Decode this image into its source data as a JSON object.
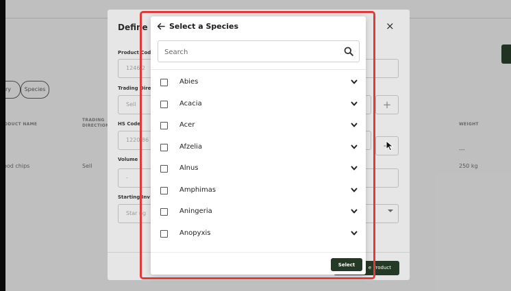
{
  "background": {
    "chips": [
      "ry",
      "Species"
    ],
    "columns": [
      "ODUCT NAME",
      "TRADING DIRECTION",
      "WEIGHT"
    ],
    "row": {
      "product": "ood chips",
      "direction": "Sell",
      "weight": "250 kg",
      "weight_above": "---"
    }
  },
  "define_modal": {
    "title": "Define P",
    "fields": [
      {
        "label": "Product Cod",
        "value": "1246 2"
      },
      {
        "label": "Trading Dire",
        "value": "Sell"
      },
      {
        "label": "HS Code",
        "value": "1220 86"
      },
      {
        "label": "Volume",
        "value": "-"
      },
      {
        "label": "Starting Inv",
        "value": "Star ng"
      }
    ],
    "primary_button": "e Product",
    "close_symbol": "×",
    "plus_symbol": "+"
  },
  "species_modal": {
    "title": "Select a Species",
    "search_placeholder": "Search",
    "items": [
      "Abies",
      "Acacia",
      "Acer",
      "Afzelia",
      "Alnus",
      "Amphimas",
      "Aningeria",
      "Anopyxis"
    ],
    "select_button": "Select"
  },
  "colors": {
    "brand_green": "#253a26",
    "highlight_red": "#e23a3a",
    "backdrop": "#dcdcdc"
  },
  "icons": [
    "back-arrow-icon",
    "search-icon",
    "chevron-down-icon",
    "close-icon",
    "plus-icon",
    "cursor-icon"
  ]
}
